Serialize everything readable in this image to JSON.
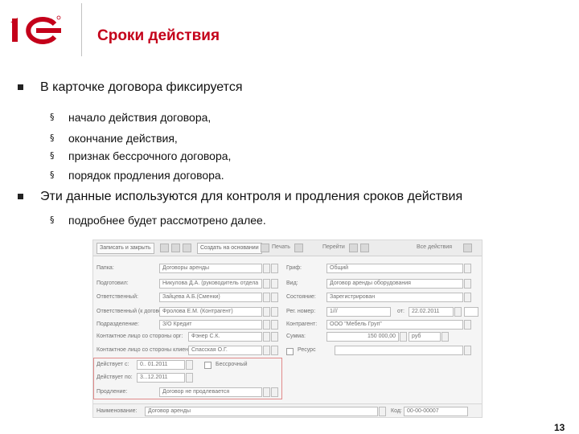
{
  "slide": {
    "title": "Сроки действия",
    "page_number": "13"
  },
  "bullets": [
    {
      "text": "В карточке договора фиксируется",
      "sub": [
        "начало действия договора,",
        "окончание действия,",
        "признак бессрочного договора,",
        "порядок продления договора."
      ]
    },
    {
      "text": "Эти данные используются для контроля и продления сроков действия",
      "sub": [
        "подробнее  будет рассмотрено далее."
      ]
    }
  ],
  "form": {
    "toolbar": {
      "save_close": "Записать и закрыть",
      "create_based": "Создать на основании",
      "print": "Печать",
      "go": "Перейти",
      "all_actions": "Все действия"
    },
    "left": [
      {
        "label": "Папка:",
        "value": "Договоры аренды"
      },
      {
        "label": "Подготовил:",
        "value": "Никулова Д.А. (руководитель отдела"
      },
      {
        "label": "Ответственный:",
        "value": "Зайцева А.Б.(Сменки)"
      },
      {
        "label": "Ответственный (к договору):",
        "value": "Фролова Е.М. (Контрагент)"
      },
      {
        "label": "Подразделение:",
        "value": "З/О Кредит"
      },
      {
        "label": "Контактное лицо со стороны орг:",
        "value": "Фэнер С.К."
      },
      {
        "label": "Контактное лицо со стороны клиента:",
        "value": "Спасская О.Г."
      }
    ],
    "dates": {
      "start_label": "Действует с:",
      "start_value": "0.. 01.2011",
      "end_label": "Действует по:",
      "end_value": "3...12.2011",
      "indefinite_label": "Бессрочный",
      "renewal_label": "Продление:",
      "renewal_value": "Договор не продлевается"
    },
    "right": [
      {
        "label": "Гриф:",
        "value": "Общий"
      },
      {
        "label": "Вид:",
        "value": "Договор аренды оборудования"
      },
      {
        "label": "Состояние:",
        "value": "Зарегистрирован"
      },
      {
        "label": "Рег. номер:",
        "value": "1///",
        "extra_label": "от:",
        "extra_value": "22.02.2011"
      },
      {
        "label": "Контрагент:",
        "value": "ООО \"Мебель Груп\""
      },
      {
        "label": "Сумма:",
        "value": "150 000,00",
        "extra_value": "руб"
      },
      {
        "label": "Ресурс",
        "value": ""
      }
    ],
    "bottom": {
      "label": "Наименование:",
      "value": "Договор аренды",
      "code_label": "Код:",
      "code_value": "00-00-00007"
    }
  }
}
